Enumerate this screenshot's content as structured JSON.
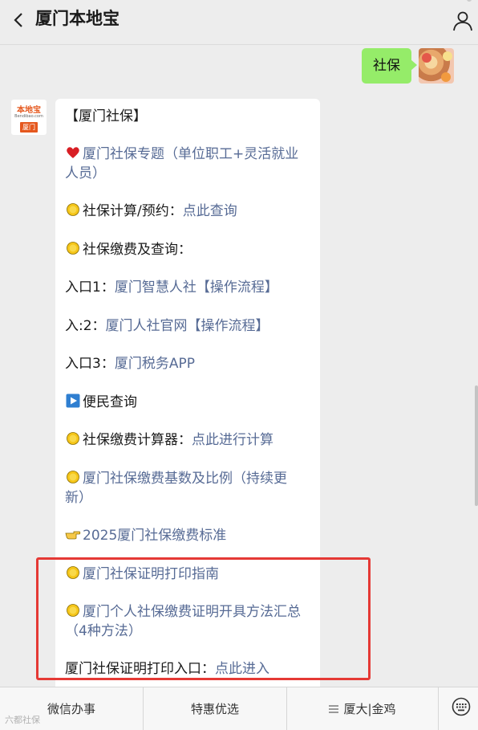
{
  "header": {
    "title": "厦门本地宝"
  },
  "user_message": {
    "text": "社保"
  },
  "bot_avatar": {
    "brand": "本地宝",
    "domain": "Bendibao.com",
    "city": "厦门"
  },
  "card": {
    "heading": "【厦门社保】",
    "items": [
      {
        "text": "厦门社保专题（单位职工+灵活就业",
        "text2": "人员）"
      },
      {
        "label": "社保计算/预约：",
        "link": "点此查询"
      },
      {
        "label": "社保缴费及查询："
      },
      {
        "label": "入口1：",
        "link": "厦门智慧人社【操作流程】"
      },
      {
        "label": "入:2：",
        "link": "厦门人社官网【操作流程】"
      },
      {
        "label": "入口3：",
        "link": "厦门税务APP"
      },
      {
        "label": "便民查询"
      },
      {
        "label": "社保缴费计算器：",
        "link": "点此进行计算"
      },
      {
        "link": "厦门社保缴费基数及比例（持续更",
        "link2": "新）"
      },
      {
        "link": "2025厦门社保缴费标准"
      },
      {
        "link": "厦门社保证明打印指南"
      },
      {
        "link": "厦门个人社保缴费证明开具方法汇总",
        "link2": "（4种方法）"
      },
      {
        "label": "厦门社保证明打印入口：",
        "link": "点此进入"
      }
    ]
  },
  "bottom_menu": {
    "tab1": "微信办事",
    "tab2": "特惠优选",
    "tab3": "厦大|金鸡"
  },
  "watermark": "六都社保",
  "colors": {
    "link": "#576b95",
    "user_bubble": "#95ec69",
    "highlight_box": "#e53935",
    "brand_orange": "#e5581e"
  },
  "icons": [
    "back-arrow-icon",
    "profile-icon",
    "heart-icon",
    "sun-icon",
    "play-icon",
    "pointing-hand-icon",
    "menu-icon",
    "keyboard-icon"
  ]
}
